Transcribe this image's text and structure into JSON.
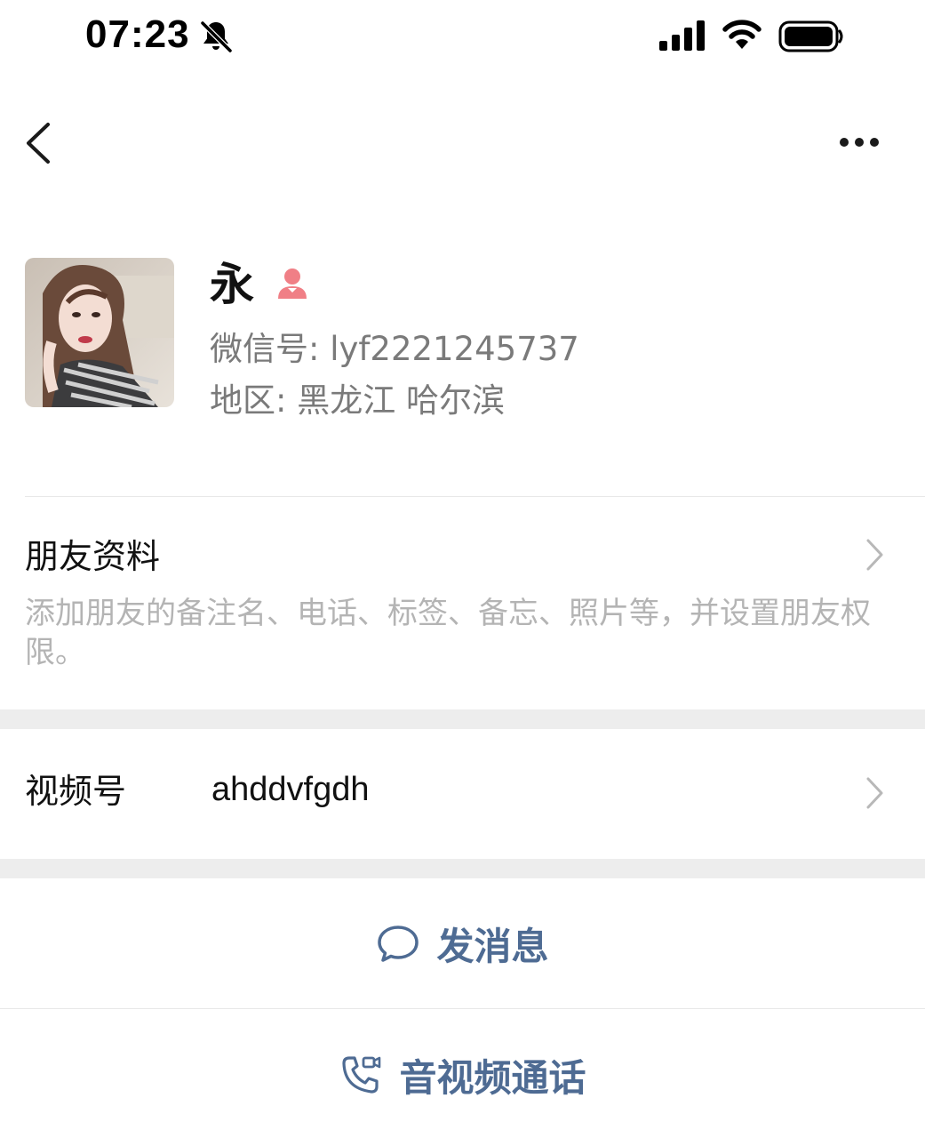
{
  "status_bar": {
    "time": "07:23",
    "icons": [
      "bell-muted-icon",
      "cellular-signal-icon",
      "wifi-icon",
      "battery-icon"
    ]
  },
  "nav": {
    "back_icon": "chevron-left-icon",
    "more_icon": "more-dots-icon"
  },
  "profile": {
    "name": "永",
    "gender_icon": "female-icon",
    "wechat_id": "微信号: lyf2221245737",
    "region": "地区: 黑龙江 哈尔滨"
  },
  "friend_info": {
    "title": "朋友资料",
    "description": "添加朋友的备注名、电话、标签、备忘、照片等，并设置朋友权限。"
  },
  "channels": {
    "label": "视频号",
    "value": "ahddvfgdh"
  },
  "actions": {
    "message": "发消息",
    "call": "音视频通话"
  },
  "colors": {
    "accent": "#4e6b93",
    "female_icon": "#f07f86",
    "section_gap": "#ededed",
    "secondary_text": "#7a7a7a",
    "hint_text": "#b4b4b4"
  }
}
